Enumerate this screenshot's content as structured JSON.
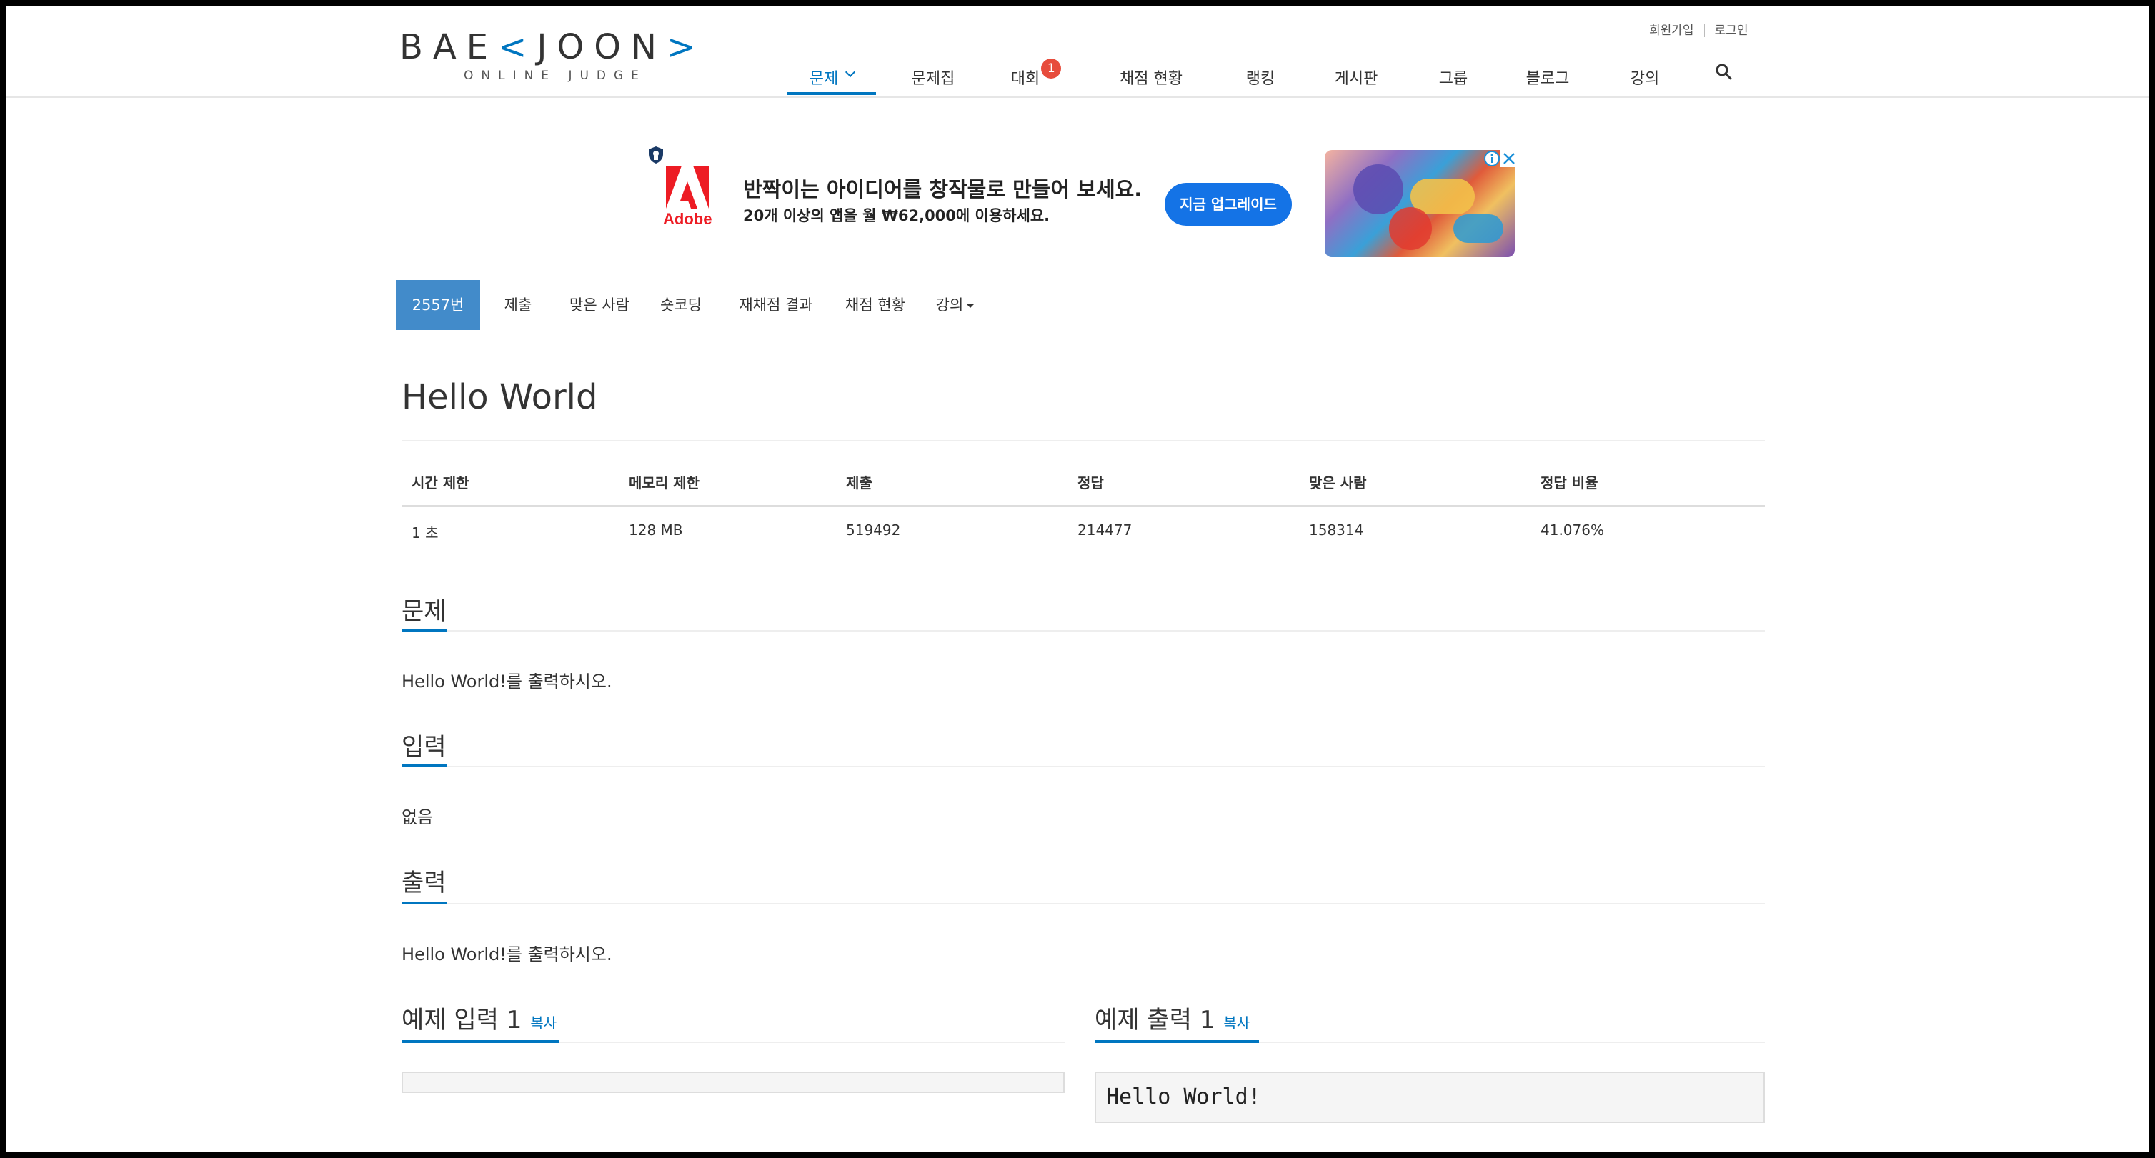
{
  "brand": {
    "logo_main_left": "BAE",
    "logo_main_accent1": "<",
    "logo_main_mid": "JOON",
    "logo_main_accent2": ">",
    "logo_sub": "ONLINE JUDGE"
  },
  "top_links": {
    "signup": "회원가입",
    "login": "로그인"
  },
  "nav": {
    "items": [
      {
        "label": "문제",
        "active": true,
        "dropdown": true
      },
      {
        "label": "문제집"
      },
      {
        "label": "대회",
        "badge": "1"
      },
      {
        "label": "채점 현황"
      },
      {
        "label": "랭킹"
      },
      {
        "label": "게시판"
      },
      {
        "label": "그룹"
      },
      {
        "label": "블로그"
      },
      {
        "label": "강의"
      }
    ],
    "search_icon": "search-icon",
    "accent_color": "#0076c0",
    "badge_color": "#e74c3c"
  },
  "ad": {
    "brand": "Adobe",
    "headline": "반짝이는 아이디어를 창작물로 만들어 보세요.",
    "subline": "20개 이상의 앱을 월 ₩62,000에 이용하세요.",
    "cta": "지금 업그레이드",
    "cta_color": "#1473e6"
  },
  "subnav": {
    "items": [
      {
        "label": "2557번",
        "active": true
      },
      {
        "label": "제출"
      },
      {
        "label": "맞은 사람"
      },
      {
        "label": "숏코딩"
      },
      {
        "label": "재채점 결과"
      },
      {
        "label": "채점 현황"
      },
      {
        "label": "강의",
        "dropdown": true
      }
    ],
    "active_color": "#428bca"
  },
  "problem": {
    "title": "Hello World",
    "table": {
      "headers": [
        "시간 제한",
        "메모리 제한",
        "제출",
        "정답",
        "맞은 사람",
        "정답 비율"
      ],
      "values": [
        "1 초",
        "128 MB",
        "519492",
        "214477",
        "158314",
        "41.076%"
      ]
    },
    "sections": {
      "problem_heading": "문제",
      "problem_text": "Hello World!를 출력하시오.",
      "input_heading": "입력",
      "input_text": "없음",
      "output_heading": "출력",
      "output_text": "Hello World!를 출력하시오."
    },
    "samples": {
      "input_heading": "예제 입력 1",
      "output_heading": "예제 출력 1",
      "copy_label": "복사",
      "input_value": "",
      "output_value": "Hello World!"
    }
  }
}
